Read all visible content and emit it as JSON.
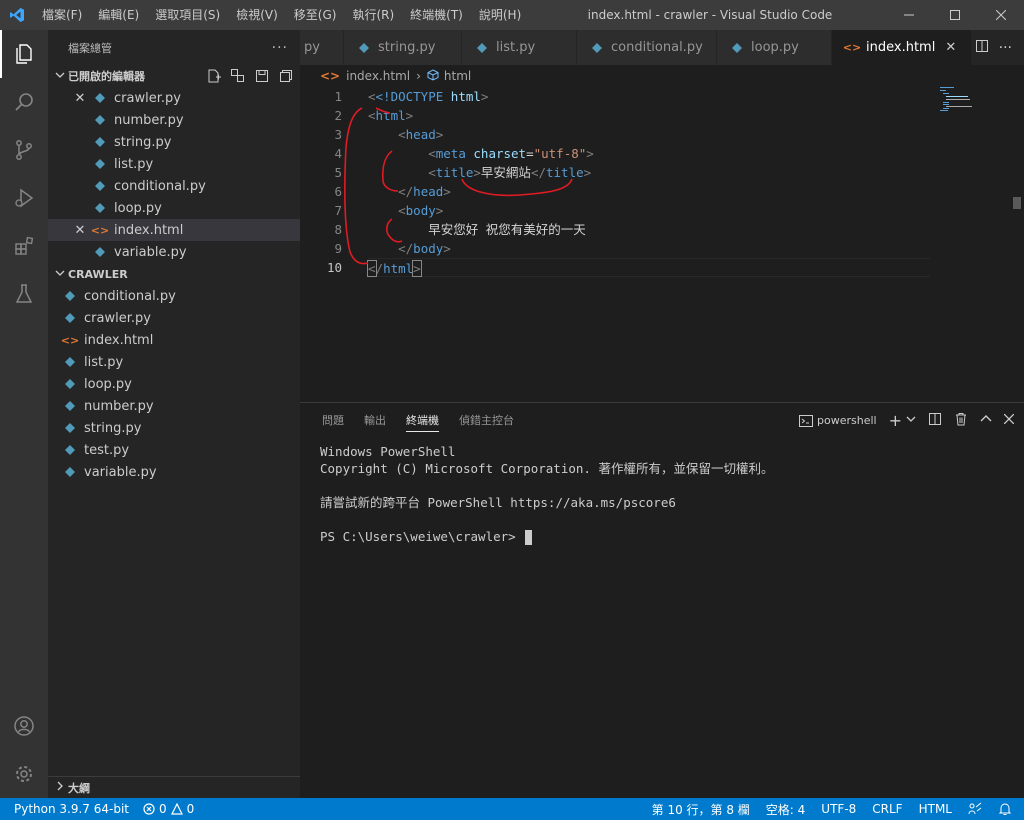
{
  "titlebar": {
    "menus": [
      "檔案(F)",
      "編輯(E)",
      "選取項目(S)",
      "檢視(V)",
      "移至(G)",
      "執行(R)",
      "終端機(T)",
      "說明(H)"
    ],
    "title": "index.html - crawler - Visual Studio Code"
  },
  "sidebar": {
    "header": "檔案總管",
    "open_editors": {
      "title": "已開啟的編輯器",
      "items": [
        {
          "name": "crawler.py",
          "type": "py"
        },
        {
          "name": "number.py",
          "type": "py"
        },
        {
          "name": "string.py",
          "type": "py"
        },
        {
          "name": "list.py",
          "type": "py"
        },
        {
          "name": "conditional.py",
          "type": "py"
        },
        {
          "name": "loop.py",
          "type": "py"
        },
        {
          "name": "index.html",
          "type": "html"
        },
        {
          "name": "variable.py",
          "type": "py"
        }
      ]
    },
    "folder": {
      "title": "CRAWLER",
      "items": [
        {
          "name": "conditional.py",
          "type": "py"
        },
        {
          "name": "crawler.py",
          "type": "py"
        },
        {
          "name": "index.html",
          "type": "html"
        },
        {
          "name": "list.py",
          "type": "py"
        },
        {
          "name": "loop.py",
          "type": "py"
        },
        {
          "name": "number.py",
          "type": "py"
        },
        {
          "name": "string.py",
          "type": "py"
        },
        {
          "name": "test.py",
          "type": "py"
        },
        {
          "name": "variable.py",
          "type": "py"
        }
      ]
    },
    "outline": "大綱"
  },
  "tabs": [
    {
      "label": "py",
      "type": "py"
    },
    {
      "label": "string.py",
      "type": "py"
    },
    {
      "label": "list.py",
      "type": "py"
    },
    {
      "label": "conditional.py",
      "type": "py"
    },
    {
      "label": "loop.py",
      "type": "py"
    },
    {
      "label": "index.html",
      "type": "html"
    }
  ],
  "breadcrumb": {
    "file": "index.html",
    "symbol": "html"
  },
  "editor": {
    "line_numbers": [
      "1",
      "2",
      "3",
      "4",
      "5",
      "6",
      "7",
      "8",
      "9",
      "10"
    ],
    "current_line": "10",
    "lines": {
      "l1_doctype": "<!DOCTYPE",
      "l1_html": "html",
      "html": "html",
      "head": "head",
      "meta": "meta",
      "charset": "charset",
      "charset_val": "\"utf-8\"",
      "title": "title",
      "title_text": "早安網站",
      "body": "body",
      "body_text": "早安您好 祝您有美好的一天"
    }
  },
  "panel": {
    "tabs": [
      "問題",
      "輸出",
      "終端機",
      "偵錯主控台"
    ],
    "active_tab": "終端機",
    "shell": "powershell",
    "terminal_lines": [
      "Windows PowerShell",
      "Copyright (C) Microsoft Corporation. 著作權所有，並保留一切權利。",
      "",
      "請嘗試新的跨平台 PowerShell https://aka.ms/pscore6",
      "",
      "PS C:\\Users\\weiwe\\crawler> "
    ]
  },
  "statusbar": {
    "python": "Python 3.9.7 64-bit",
    "errors": "0",
    "warnings": "0",
    "position": "第 10 行，第 8 欄",
    "spaces": "空格: 4",
    "encoding": "UTF-8",
    "eol": "CRLF",
    "language": "HTML"
  },
  "colors": {
    "accent": "#007acc",
    "py_icon": "#519aba",
    "html_icon": "#e37933",
    "annotation": "#e01b24"
  }
}
